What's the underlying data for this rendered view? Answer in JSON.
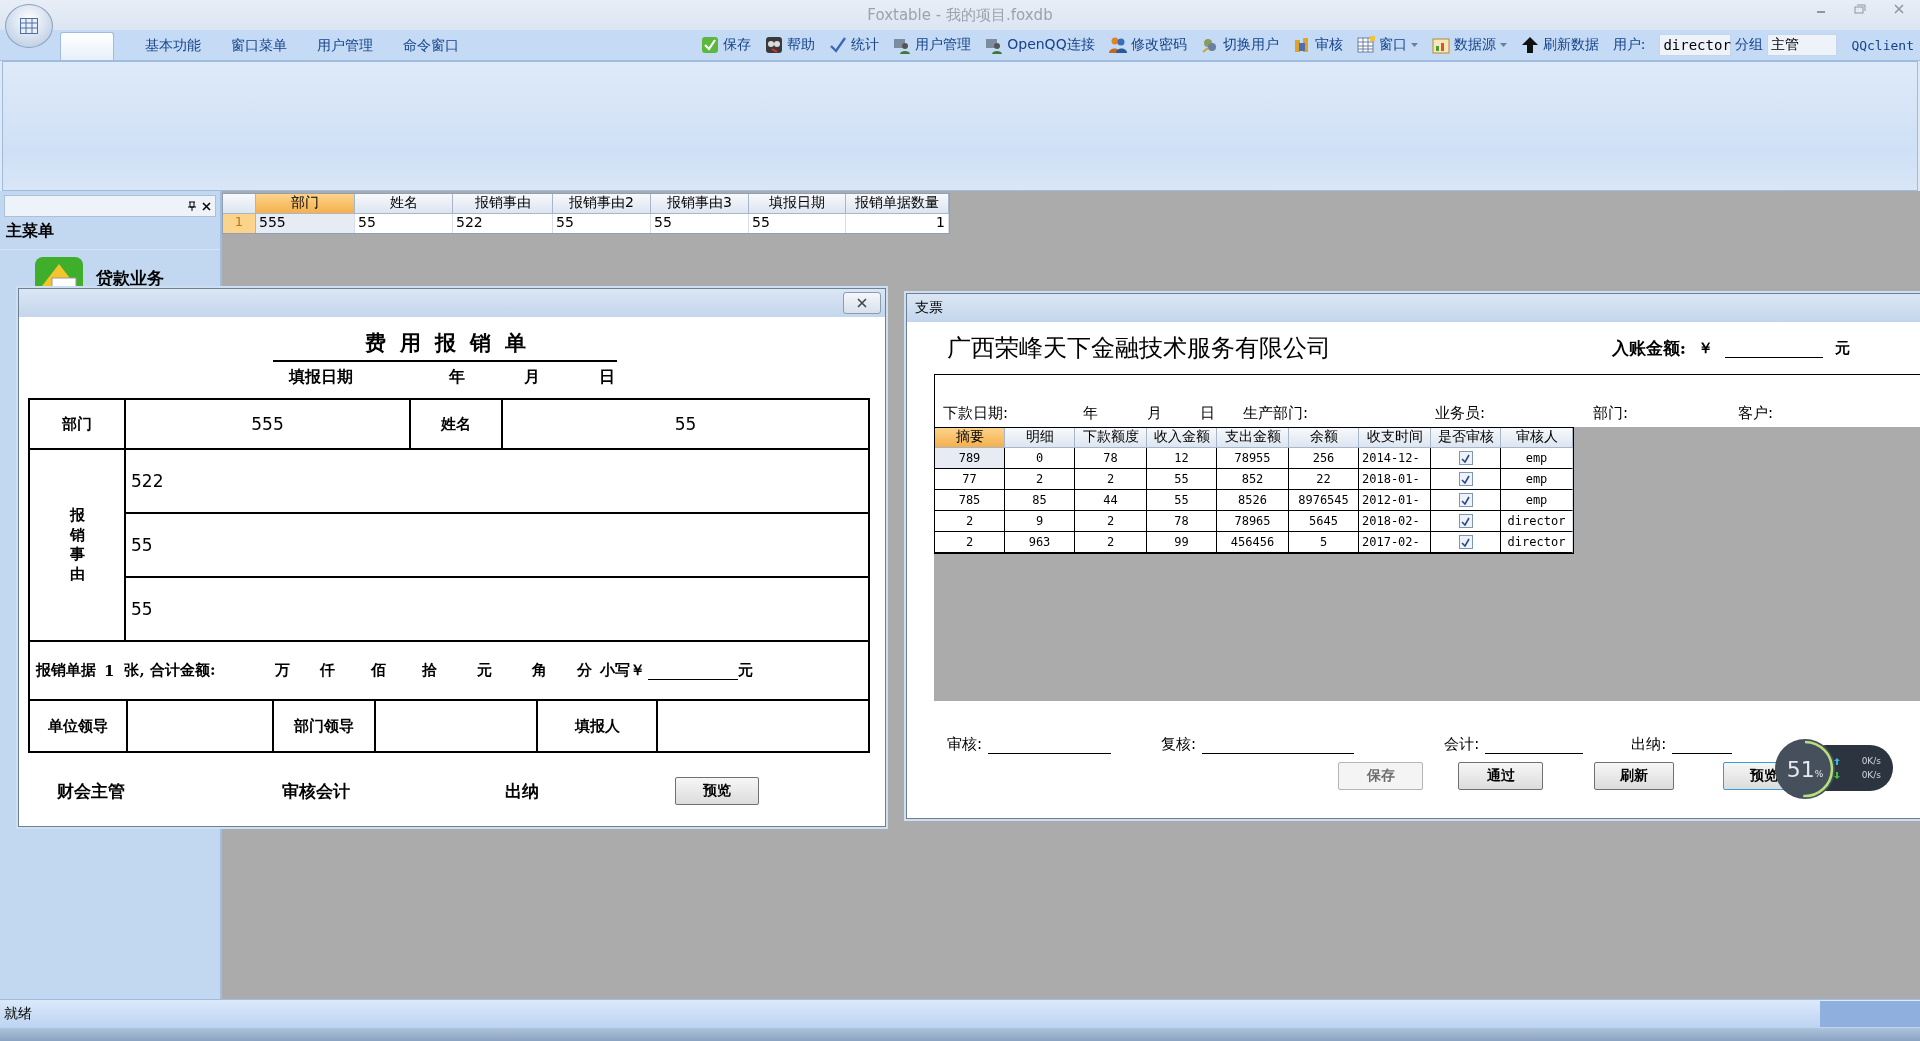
{
  "window": {
    "title": "Foxtable - 我的项目.foxdb"
  },
  "ribbon": {
    "tabs": [
      {
        "label": "基本功能",
        "selected": false
      },
      {
        "label": "窗口菜单",
        "selected": false
      },
      {
        "label": "用户管理",
        "selected": false
      },
      {
        "label": "命令窗口",
        "selected": false
      }
    ]
  },
  "toolbar": [
    {
      "label": "保存",
      "kind": "save",
      "dropdown": false
    },
    {
      "label": "帮助",
      "kind": "help",
      "dropdown": false
    },
    {
      "label": "统计",
      "kind": "tick",
      "dropdown": false
    },
    {
      "label": "用户管理",
      "kind": "users",
      "dropdown": false
    },
    {
      "label": "OpenQQ连接",
      "kind": "users",
      "dropdown": false
    },
    {
      "label": "修改密码",
      "kind": "people",
      "dropdown": false
    },
    {
      "label": "切换用户",
      "kind": "switch",
      "dropdown": false
    },
    {
      "label": "审核",
      "kind": "audit",
      "dropdown": false
    },
    {
      "label": "窗口",
      "kind": "window",
      "dropdown": true
    },
    {
      "label": "数据源",
      "kind": "datasource",
      "dropdown": true
    },
    {
      "label": "刷新数据",
      "kind": "refresh",
      "dropdown": false
    }
  ],
  "user": {
    "label": "用户:",
    "value": "director"
  },
  "group": {
    "label": "分组",
    "value": "主管"
  },
  "qq_client": "QQclient",
  "sidebar": {
    "title": "主菜单",
    "items": [
      {
        "label": "贷款业务"
      }
    ]
  },
  "grid": {
    "columns": [
      {
        "label": "部门",
        "selected": true
      },
      {
        "label": "姓名",
        "selected": false
      },
      {
        "label": "报销事由",
        "selected": false
      },
      {
        "label": "报销事由2",
        "selected": false
      },
      {
        "label": "报销事由3",
        "selected": false
      },
      {
        "label": "填报日期",
        "selected": false
      },
      {
        "label": "报销单据数量",
        "selected": false
      }
    ],
    "rows": [
      {
        "number": "1",
        "selected": true,
        "cells": [
          "555",
          "55",
          "522",
          "55",
          "55",
          "55",
          "1"
        ]
      }
    ]
  },
  "expense_form": {
    "title": "费用报销单",
    "date_label": "填报日期",
    "date_parts": [
      "年",
      "月",
      "日"
    ],
    "dept_label": "部门",
    "dept": "555",
    "name_label": "姓名",
    "name": "55",
    "reason_label": "报销事由",
    "reasons": [
      "522",
      "55",
      "55"
    ],
    "receipts_label": "报销单据",
    "receipts": "1",
    "total_label": "张, 合计金额:",
    "units": [
      "万",
      "仟",
      "佰",
      "拾",
      "元",
      "角",
      "分"
    ],
    "small_label": "小写￥",
    "yuan": "元",
    "signers": [
      "单位领导",
      "部门领导",
      "填报人"
    ],
    "footer": [
      "财会主管",
      "审核会计",
      "出纳"
    ],
    "button": "预览"
  },
  "cheque": {
    "title": "支票",
    "company": "广西荣峰天下金融技术服务有限公司",
    "amount_label": "入账金额:",
    "currency": "￥",
    "yuan": "元",
    "fields": [
      "下款日期:",
      "年",
      "月",
      "日",
      "生产部门:",
      "业务员:",
      "部门:",
      "客户:"
    ],
    "columns": [
      {
        "label": "摘要",
        "selected": true
      },
      {
        "label": "明细",
        "selected": false
      },
      {
        "label": "下款额度",
        "selected": false
      },
      {
        "label": "收入金额",
        "selected": false
      },
      {
        "label": "支出金额",
        "selected": false
      },
      {
        "label": "余额",
        "selected": false
      },
      {
        "label": "收支时间",
        "selected": false
      },
      {
        "label": "是否审核",
        "selected": false
      },
      {
        "label": "审核人",
        "selected": false
      }
    ],
    "rows": [
      {
        "selected": true,
        "cells": [
          "789",
          "0",
          "78",
          "12",
          "78955",
          "256",
          "2014-12-"
        ],
        "checked": true,
        "reviewer": "emp"
      },
      {
        "selected": false,
        "cells": [
          "77",
          "2",
          "2",
          "55",
          "852",
          "22",
          "2018-01-"
        ],
        "checked": true,
        "reviewer": "emp"
      },
      {
        "selected": false,
        "cells": [
          "785",
          "85",
          "44",
          "55",
          "8526",
          "8976545",
          "2012-01-"
        ],
        "checked": true,
        "reviewer": "emp"
      },
      {
        "selected": false,
        "cells": [
          "2",
          "9",
          "2",
          "78",
          "78965",
          "5645",
          "2018-02-"
        ],
        "checked": true,
        "reviewer": "director"
      },
      {
        "selected": false,
        "cells": [
          "2",
          "963",
          "2",
          "99",
          "456456",
          "5",
          "2017-02-"
        ],
        "checked": true,
        "reviewer": "director"
      }
    ],
    "signatures": [
      "审核:",
      "复核:",
      "会计:",
      "出纳:"
    ],
    "buttons": [
      {
        "label": "保存",
        "disabled": true,
        "focused": false
      },
      {
        "label": "通过",
        "disabled": false,
        "focused": false
      },
      {
        "label": "刷新",
        "disabled": false,
        "focused": false
      },
      {
        "label": "预览",
        "disabled": false,
        "focused": true
      }
    ]
  },
  "net_widget": {
    "percent": "51",
    "unit": "%",
    "level": 0.51,
    "up": "0K/s",
    "down": "0K/s"
  },
  "status_bar": {
    "text": "就绪"
  }
}
